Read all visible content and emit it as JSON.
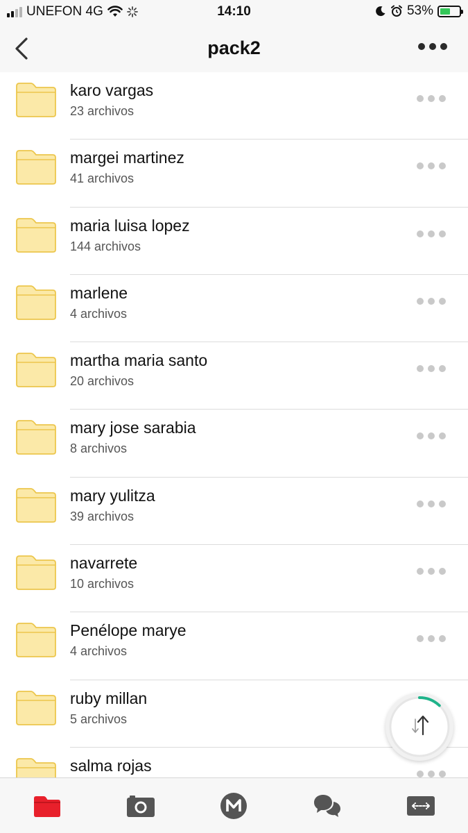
{
  "status_bar": {
    "carrier": "UNEFON 4G",
    "time": "14:10",
    "battery": "53%",
    "battery_level": 0.53
  },
  "nav": {
    "title": "pack2"
  },
  "folders": [
    {
      "name": "karo vargas",
      "count": "23 archivos"
    },
    {
      "name": "margei martinez",
      "count": "41 archivos"
    },
    {
      "name": "maria luisa lopez",
      "count": "144 archivos"
    },
    {
      "name": "marlene",
      "count": "4 archivos"
    },
    {
      "name": "martha maria santo",
      "count": "20 archivos"
    },
    {
      "name": "mary jose sarabia",
      "count": "8 archivos"
    },
    {
      "name": "mary yulitza",
      "count": "39 archivos"
    },
    {
      "name": "navarrete",
      "count": "10 archivos"
    },
    {
      "name": "Penélope marye",
      "count": "4 archivos"
    },
    {
      "name": "ruby millan",
      "count": "5 archivos"
    },
    {
      "name": "salma rojas",
      "count": ""
    }
  ],
  "transfer": {
    "icon": "transfer-arrows-icon",
    "progress": 0.12
  },
  "tabs": [
    {
      "id": "cloud-drive",
      "icon": "folder-icon",
      "active": true
    },
    {
      "id": "camera-uploads",
      "icon": "camera-icon",
      "active": false
    },
    {
      "id": "home",
      "icon": "mega-logo-icon",
      "active": false
    },
    {
      "id": "chat",
      "icon": "chat-bubbles-icon",
      "active": false
    },
    {
      "id": "transfers",
      "icon": "transfers-icon",
      "active": false
    }
  ],
  "colors": {
    "accent_red": "#e8202b",
    "folder_fill": "#fbe9a8",
    "folder_stroke": "#ecc64c",
    "progress_green": "#1fb38a"
  }
}
